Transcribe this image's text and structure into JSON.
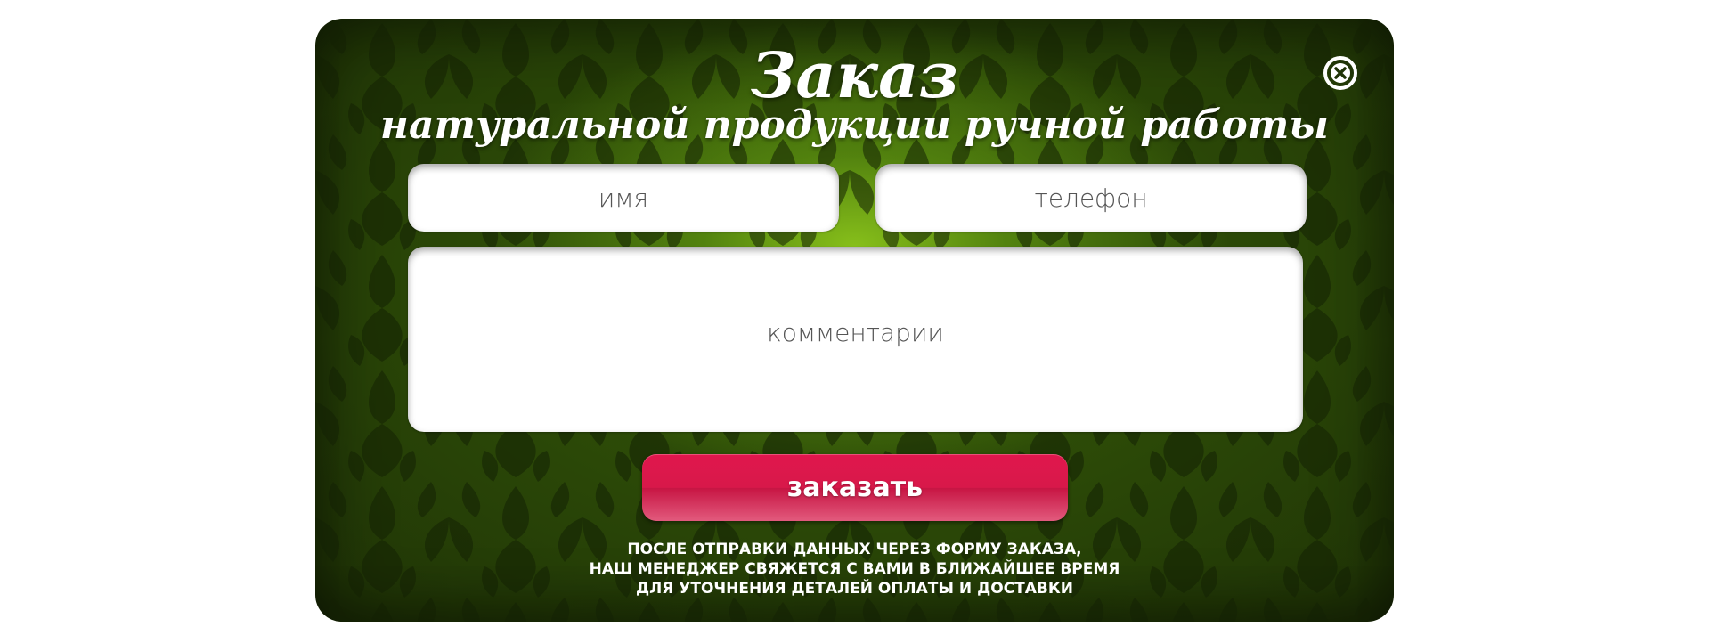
{
  "modal": {
    "title": "Заказ",
    "subtitle": "натуральной продукции ручной работы",
    "close_icon": "close-circle-icon"
  },
  "form": {
    "name_placeholder": "имя",
    "phone_placeholder": "телефон",
    "comment_placeholder": "комментарии",
    "submit_label": "заказать"
  },
  "notice": {
    "line1": "ПОСЛЕ ОТПРАВКИ ДАННЫХ ЧЕРЕЗ ФОРМУ ЗАКАЗА,",
    "line2": "НАШ МЕНЕДЖЕР СВЯЖЕТСЯ С ВАМИ В БЛИЖАЙШЕЕ ВРЕМЯ",
    "line3": "ДЛЯ УТОЧНЕНИЯ ДЕТАЛЕЙ ОПЛАТЫ И ДОСТАВКИ"
  },
  "colors": {
    "background_dark": "#1f3306",
    "background_glow": "#96d21e",
    "button": "#d8184a",
    "text": "#ffffff"
  }
}
